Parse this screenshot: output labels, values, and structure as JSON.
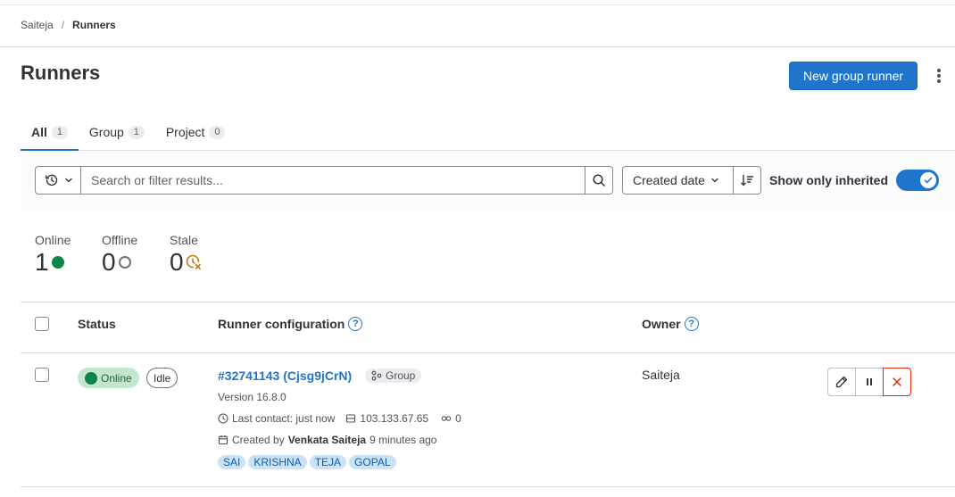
{
  "breadcrumb": {
    "parent": "Saiteja",
    "current": "Runners"
  },
  "page": {
    "title": "Runners",
    "new_runner_label": "New group runner"
  },
  "tabs": [
    {
      "label": "All",
      "count": "1"
    },
    {
      "label": "Group",
      "count": "1"
    },
    {
      "label": "Project",
      "count": "0"
    }
  ],
  "filter": {
    "search_placeholder": "Search or filter results...",
    "sort_label": "Created date",
    "toggle_label": "Show only inherited",
    "toggle_on": true
  },
  "stats": [
    {
      "label": "Online",
      "value": "1"
    },
    {
      "label": "Offline",
      "value": "0"
    },
    {
      "label": "Stale",
      "value": "0"
    }
  ],
  "table": {
    "headers": {
      "status": "Status",
      "config": "Runner configuration",
      "owner": "Owner"
    },
    "rows": [
      {
        "status": "Online",
        "state": "Idle",
        "runner_id": "#32741143 (Cjsg9jCrN)",
        "type": "Group",
        "version": "Version 16.8.0",
        "last_contact": "Last contact: just now",
        "ip": "103.133.67.65",
        "jobs": "0",
        "created_prefix": "Created by",
        "created_by": "Venkata Saiteja",
        "created_ago": "9 minutes ago",
        "tags": [
          "SAI",
          "KRISHNA",
          "TEJA",
          "GOPAL"
        ],
        "owner": "Saiteja"
      }
    ]
  },
  "colors": {
    "accent": "#1f75cb",
    "online": "#108548",
    "stale": "#c17d10",
    "danger": "#dd2b0e"
  }
}
